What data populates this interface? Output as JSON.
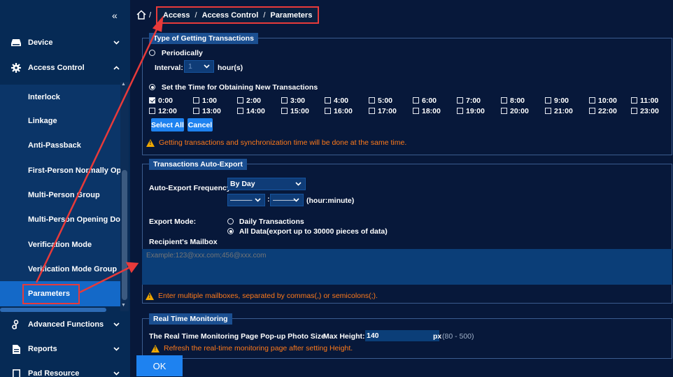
{
  "sidebar": {
    "collapse_glyph": "«",
    "main_items": [
      {
        "label": "Device",
        "icon": "device-icon",
        "chevron": "⌄"
      },
      {
        "label": "Access Control",
        "icon": "gear-icon",
        "chevron": "^"
      }
    ],
    "sub_items": [
      {
        "label": "Interlock"
      },
      {
        "label": "Linkage"
      },
      {
        "label": "Anti-Passback"
      },
      {
        "label": "First-Person Normally Op"
      },
      {
        "label": "Multi-Person Group"
      },
      {
        "label": "Multi-Person Opening Do"
      },
      {
        "label": "Verification Mode"
      },
      {
        "label": "Verification Mode Group"
      },
      {
        "label": "Parameters"
      }
    ],
    "bottom_items": [
      {
        "label": "Advanced Functions",
        "icon": "advanced-functions-icon"
      },
      {
        "label": "Reports",
        "icon": "reports-icon"
      },
      {
        "label": "Pad Resource",
        "icon": "pad-resource-icon"
      }
    ],
    "active_color": "#1469c8"
  },
  "breadcrumb": {
    "separator": "/",
    "items": [
      "Access",
      "Access Control",
      "Parameters"
    ]
  },
  "transactions": {
    "legend": "Type of Getting Transactions",
    "periodically_label": "Periodically",
    "interval_label": "Interval:",
    "interval_value": "1",
    "interval_unit": "hour(s)",
    "set_time_label": "Set the Time for Obtaining New Transactions",
    "hours_row1": [
      "0:00",
      "1:00",
      "2:00",
      "3:00",
      "4:00",
      "5:00",
      "6:00",
      "7:00",
      "8:00",
      "9:00",
      "10:00",
      "11:00"
    ],
    "hours_row2": [
      "12:00",
      "13:00",
      "14:00",
      "15:00",
      "16:00",
      "17:00",
      "18:00",
      "19:00",
      "20:00",
      "21:00",
      "22:00",
      "23:00"
    ],
    "checked_hour": "0:00",
    "select_all": "Select All",
    "cancel": "Cancel",
    "warning": "Getting transactions and synchronization time will be done at the same time."
  },
  "auto_export": {
    "legend": "Transactions Auto-Export",
    "frequency_label": "Auto-Export Frequency:",
    "frequency_value": "By Day",
    "hour_value": "———",
    "minute_value": "———",
    "time_separator": ":",
    "time_unit": "(hour:minute)",
    "export_mode_label": "Export Mode:",
    "mode_daily": "Daily Transactions",
    "mode_all": "All Data(export up to 30000 pieces of data)",
    "mailbox_label": "Recipient's Mailbox",
    "mailbox_placeholder": "Example:123@xxx.com;456@xxx.com",
    "warning": "Enter multiple mailboxes, separated by commas(,) or semicolons(;)."
  },
  "realtime": {
    "legend": "Real Time Monitoring",
    "photo_size_label": "The Real Time Monitoring Page Pop-up Photo Size",
    "max_height_label": "Max Height:",
    "max_height_value": "140",
    "px_unit": "px",
    "px_range": "(80 - 500)",
    "warning": "Refresh the real-time monitoring page after setting Height."
  },
  "ok_label": "OK",
  "colors": {
    "background": "#07183a",
    "sidebar": "#062a55",
    "accent": "#1e82f0",
    "warning_text": "#ff7a1a",
    "annotation": "#e83a3a"
  }
}
